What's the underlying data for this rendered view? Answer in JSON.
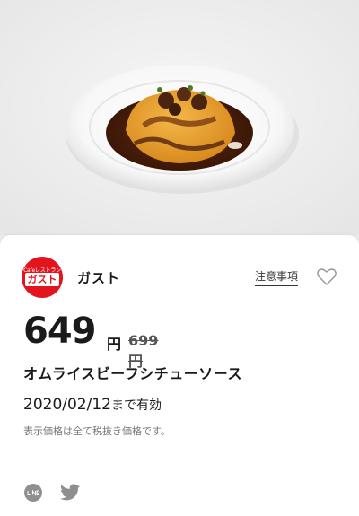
{
  "coupon": {
    "brand_logo_top": "Cafeレストラン",
    "brand_logo_main": "ガスト",
    "brand_name": "ガスト",
    "notes_label": "注意事項",
    "price": "649",
    "currency": "円",
    "original_price": "699円",
    "product_name": "オムライスビーフシチューソース",
    "valid_date": "2020/02/12",
    "valid_suffix": "まで有効",
    "price_note": "表示価格は全て税抜き価格です。"
  },
  "colors": {
    "brand_red": "#e4141e",
    "card_bg": "#ffffff",
    "page_bg": "#ebebeb"
  },
  "icons": [
    "heart-icon",
    "line-share-icon",
    "twitter-share-icon"
  ]
}
